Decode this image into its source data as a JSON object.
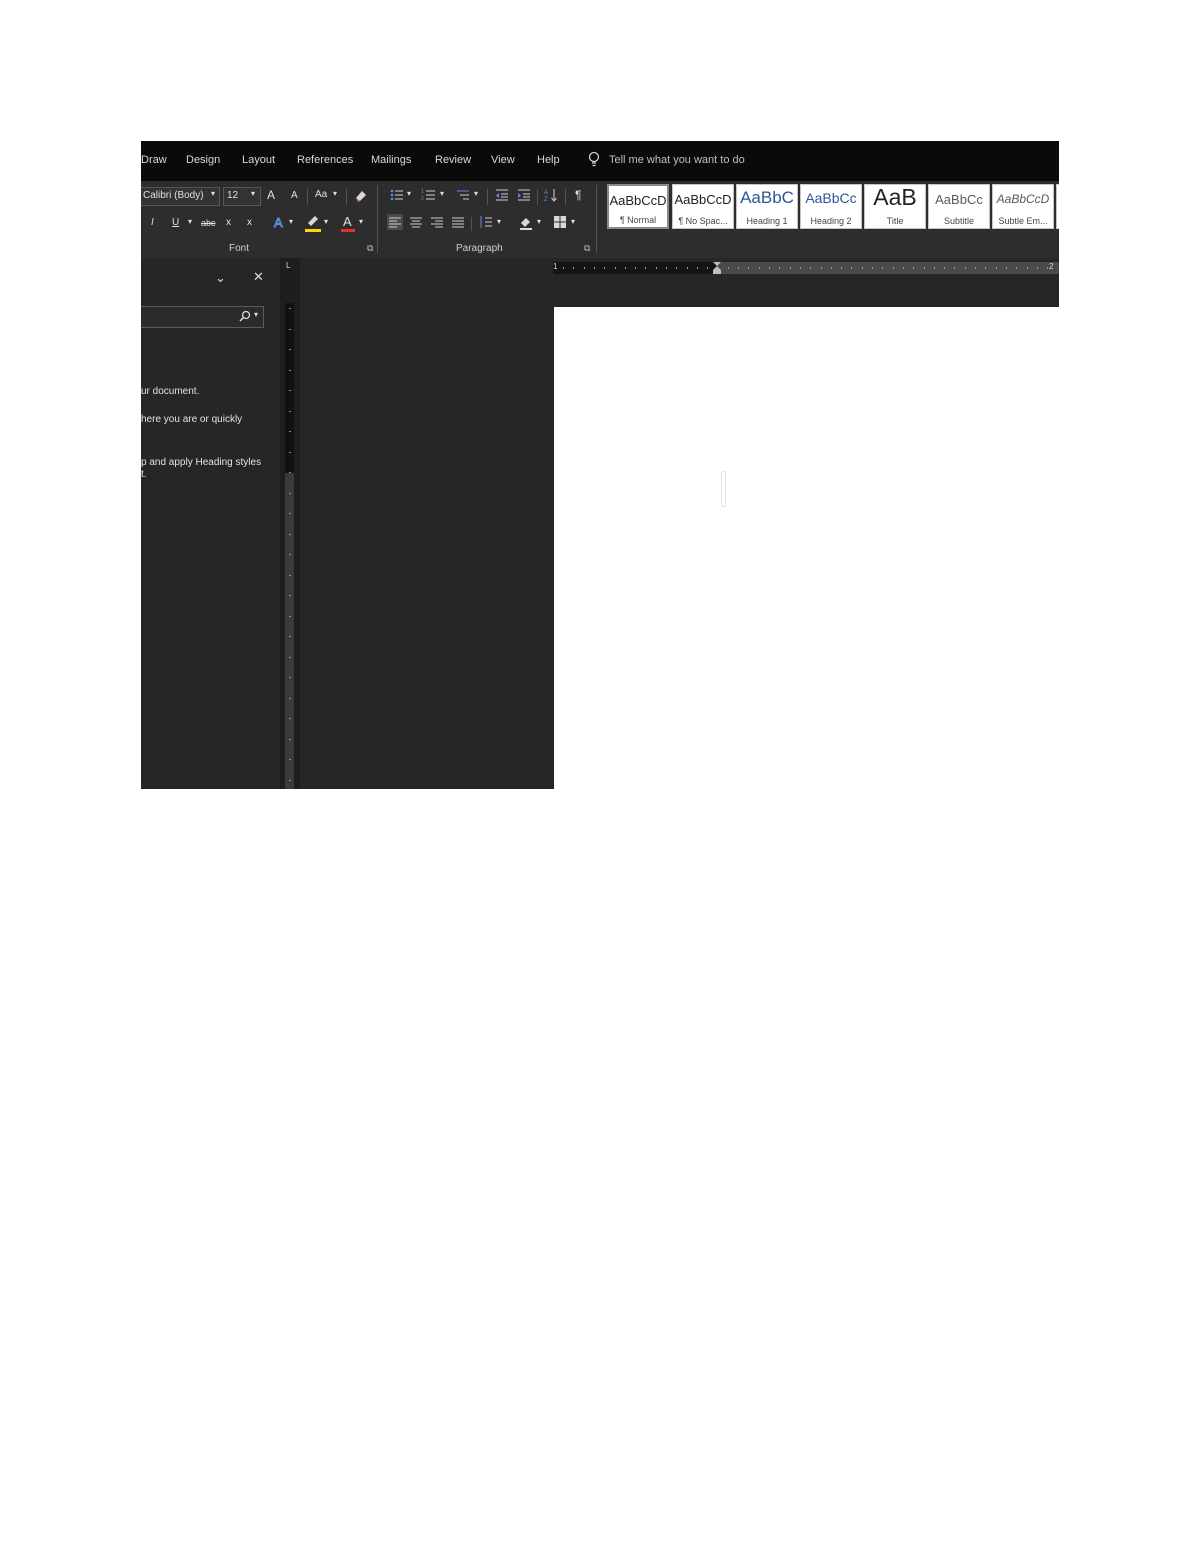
{
  "menu": {
    "items": [
      "Draw",
      "Design",
      "Layout",
      "References",
      "Mailings",
      "Review",
      "View",
      "Help"
    ],
    "tell_me": "Tell me what you want to do"
  },
  "ribbon": {
    "font_name": "Calibri (Body)",
    "font_size": "12",
    "change_case": "Aa",
    "grow_font": "A",
    "shrink_font": "A",
    "italic": "I",
    "underline": "U",
    "strikethrough": "abc",
    "subscript": "x",
    "superscript": "x",
    "font_color": "A",
    "show_marks": "¶",
    "font_group": "Font",
    "paragraph_group": "Paragraph",
    "highlight_color": "#ffd400",
    "font_color_bar": "#e03030"
  },
  "styles": [
    {
      "preview": "AaBbCcD",
      "name": "¶ Normal"
    },
    {
      "preview": "AaBbCcD",
      "name": "¶ No Spac..."
    },
    {
      "preview": "AaBbC",
      "name": "Heading 1"
    },
    {
      "preview": "AaBbCc",
      "name": "Heading 2"
    },
    {
      "preview": "AaB",
      "name": "Title"
    },
    {
      "preview": "AaBbCc",
      "name": "Subtitle"
    },
    {
      "preview": "AaBbCcD",
      "name": "Subtle Em..."
    }
  ],
  "nav_pane": {
    "lines": [
      "ur document.",
      "here you are or quickly",
      "p and apply Heading styles",
      "t."
    ]
  },
  "ruler": {
    "tab_marker": "L",
    "mark_1": "1",
    "mark_2": "2"
  }
}
